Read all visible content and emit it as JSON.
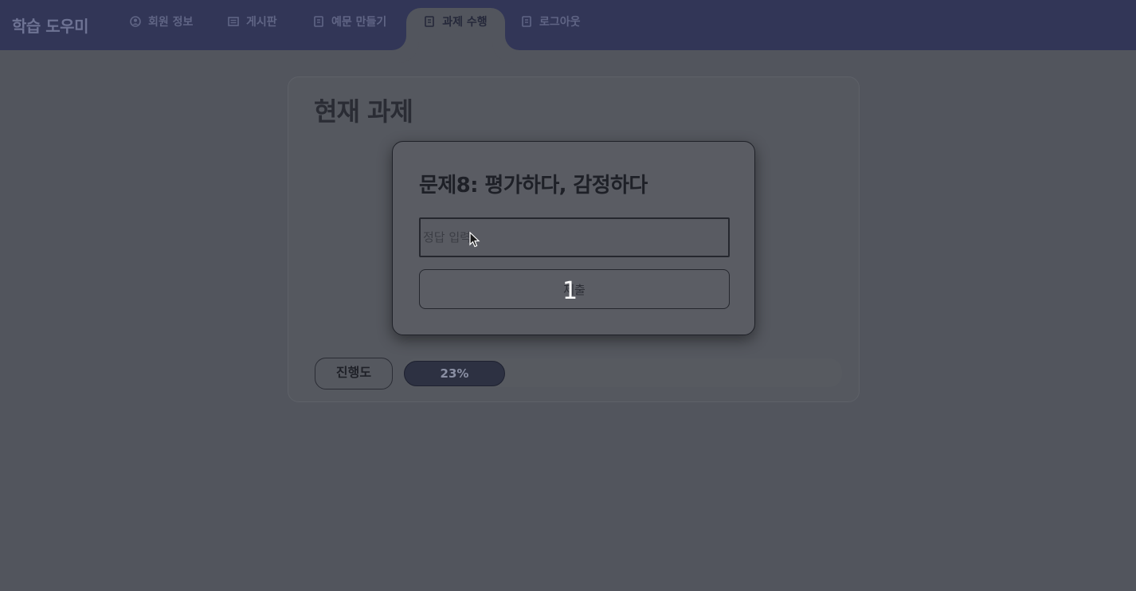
{
  "app": {
    "brand": "학습 도우미"
  },
  "nav": {
    "tabs": [
      {
        "label": "회원 정보",
        "icon": "user-circle-icon",
        "active": false
      },
      {
        "label": "게시판",
        "icon": "board-icon",
        "active": false
      },
      {
        "label": "예문 만들기",
        "icon": "document-icon",
        "active": false
      },
      {
        "label": "과제 수행",
        "icon": "document-icon",
        "active": true
      },
      {
        "label": "로그아웃",
        "icon": "document-icon",
        "active": false
      }
    ]
  },
  "main": {
    "title": "현재 과제",
    "progress": {
      "label": "진행도",
      "value_text": "23%",
      "fraction": 0.23
    }
  },
  "modal": {
    "title": "문제8: 평가하다, 감정하다",
    "answer_placeholder": "정답 입력",
    "answer_value": "",
    "submit_label": "제출",
    "overlay_digit": "1"
  },
  "colors": {
    "nav_bg": "#323657",
    "page_bg": "#52555d",
    "progress_fill": "#2d3142"
  }
}
